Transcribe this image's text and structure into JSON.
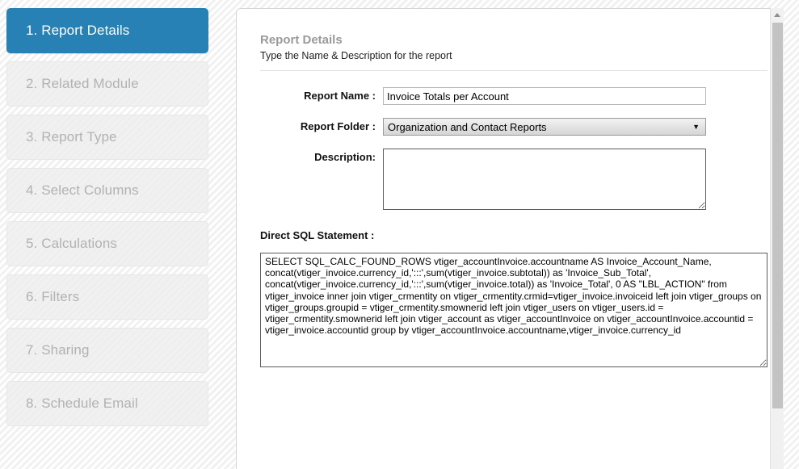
{
  "sidebar": {
    "steps": [
      {
        "label": "1. Report Details",
        "state": "active"
      },
      {
        "label": "2. Related Module",
        "state": "disabled"
      },
      {
        "label": "3. Report Type",
        "state": "disabled"
      },
      {
        "label": "4. Select Columns",
        "state": "disabled"
      },
      {
        "label": "5. Calculations",
        "state": "disabled"
      },
      {
        "label": "6. Filters",
        "state": "disabled"
      },
      {
        "label": "7. Sharing",
        "state": "disabled"
      },
      {
        "label": "8. Schedule Email",
        "state": "disabled"
      }
    ],
    "active_color": "#2781b5",
    "disabled_color": "#b2b2b2"
  },
  "main": {
    "title": "Report Details",
    "subtitle": "Type the Name & Description for the report",
    "fields": {
      "report_name": {
        "label": "Report Name :",
        "value": "Invoice Totals per Account",
        "placeholder": ""
      },
      "report_folder": {
        "label": "Report Folder :",
        "selected": "Organization and Contact Reports",
        "options": [
          "Organization and Contact Reports"
        ],
        "arrow_icon": "▼"
      },
      "description": {
        "label": "Description:",
        "value": "",
        "placeholder": ""
      },
      "direct_sql": {
        "label": "Direct SQL Statement :",
        "value": "SELECT SQL_CALC_FOUND_ROWS vtiger_accountInvoice.accountname AS Invoice_Account_Name, concat(vtiger_invoice.currency_id,':::',sum(vtiger_invoice.subtotal)) as 'Invoice_Sub_Total', concat(vtiger_invoice.currency_id,':::',sum(vtiger_invoice.total)) as 'Invoice_Total', 0 AS \"LBL_ACTION\" from vtiger_invoice inner join vtiger_crmentity on vtiger_crmentity.crmid=vtiger_invoice.invoiceid left join vtiger_groups on vtiger_groups.groupid = vtiger_crmentity.smownerid left join vtiger_users on vtiger_users.id = vtiger_crmentity.smownerid left join vtiger_account as vtiger_accountInvoice on vtiger_accountInvoice.accountid = vtiger_invoice.accountid group by vtiger_accountInvoice.accountname,vtiger_invoice.currency_id",
        "placeholder": ""
      }
    }
  },
  "scrollbar": {
    "up_arrow_icon": "scroll-up-arrow",
    "thumb_name": "vertical-scroll-thumb"
  }
}
